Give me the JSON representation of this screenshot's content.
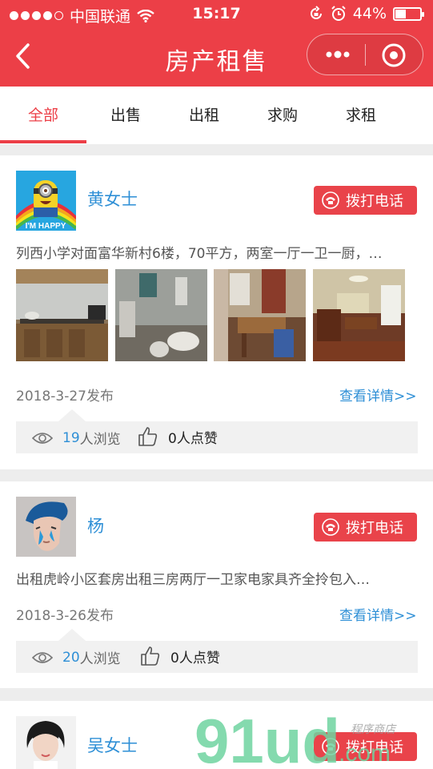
{
  "status": {
    "carrier": "中国联通",
    "time": "15:17",
    "battery": "44%",
    "battery_level": 0.44
  },
  "nav": {
    "title": "房产租售",
    "more_icon": "more-dots-icon",
    "close_icon": "record-circle-icon"
  },
  "tabs": [
    {
      "label": "全部"
    },
    {
      "label": "出售"
    },
    {
      "label": "出租"
    },
    {
      "label": "求购"
    },
    {
      "label": "求租"
    }
  ],
  "posts": [
    {
      "name": "黄女士",
      "call_label": "拨打电话",
      "desc": "列西小学对面富华新村6楼，70平方，两室一厅一卫一厨，…",
      "date": "2018-3-27发布",
      "detail": "查看详情>>",
      "views_num": "19",
      "views_suffix": "人浏览",
      "likes": "0人点赞",
      "avatar_text": "I'M HAPPY"
    },
    {
      "name": "杨",
      "call_label": "拨打电话",
      "desc": "出租虎岭小区套房出租三房两厅一卫家电家具齐全拎包入…",
      "date": "2018-3-26发布",
      "detail": "查看详情>>",
      "views_num": "20",
      "views_suffix": "人浏览",
      "likes": "0人点赞"
    },
    {
      "name": "吴女士",
      "call_label": "拨打电话"
    }
  ],
  "watermark": {
    "brand": "91ud",
    "domain": ".com",
    "tagline": "程序商店"
  },
  "colors": {
    "primary": "#ec3f47",
    "link": "#2e8fd6"
  }
}
